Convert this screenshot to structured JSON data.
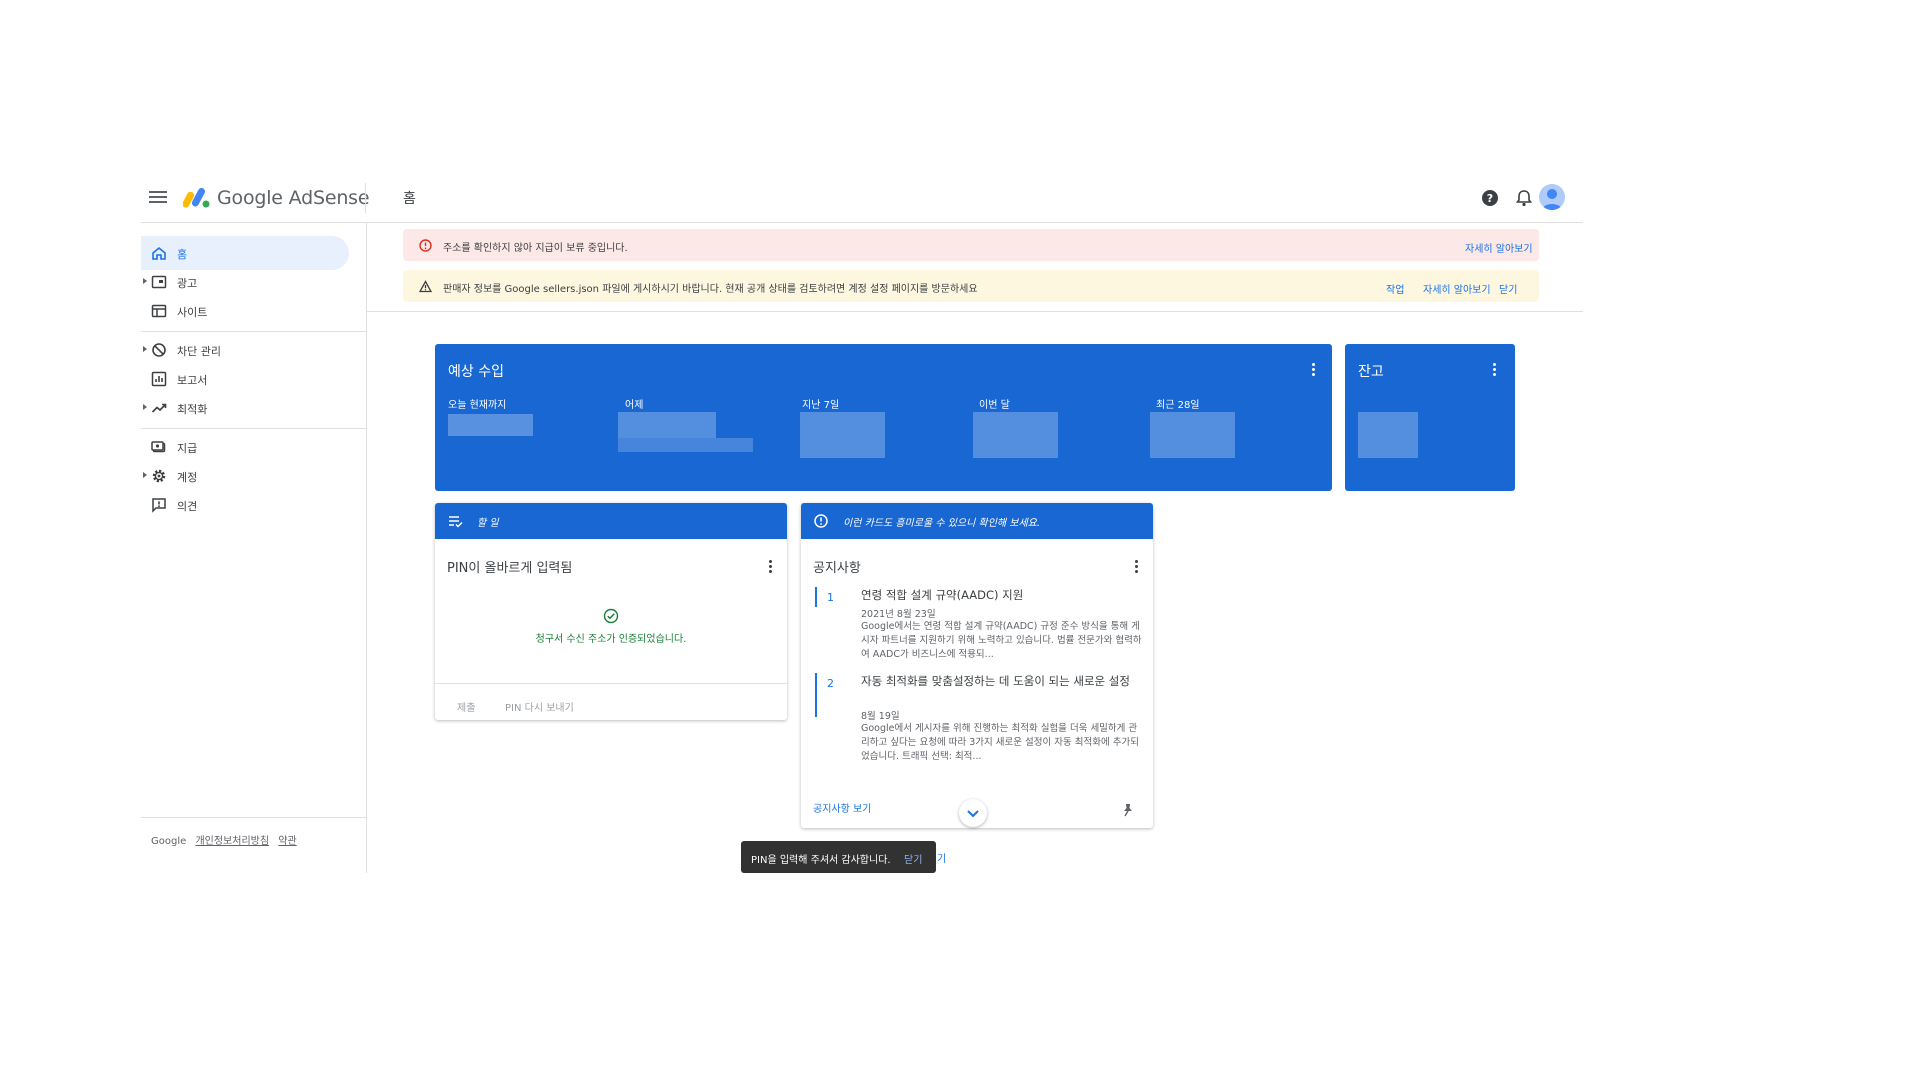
{
  "app": {
    "brand": "Google AdSense",
    "page_title": "홈",
    "colors": {
      "primary": "#1967d2",
      "link": "#1a73e8",
      "error_bg": "#fce8e6",
      "warn_bg": "#fef7e0",
      "success": "#188038"
    }
  },
  "header": {
    "icons": [
      "menu-icon",
      "help-icon",
      "notifications-icon",
      "account-avatar"
    ]
  },
  "sidebar": {
    "items": [
      {
        "label": "홈",
        "icon": "home-icon",
        "active": true
      },
      {
        "label": "광고",
        "icon": "ads-icon"
      },
      {
        "label": "사이트",
        "icon": "sites-icon"
      },
      {
        "label": "차단 관리",
        "icon": "block-icon"
      },
      {
        "label": "보고서",
        "icon": "reports-icon"
      },
      {
        "label": "최적화",
        "icon": "optimization-icon"
      },
      {
        "label": "지급",
        "icon": "payments-icon"
      },
      {
        "label": "계정",
        "icon": "settings-icon"
      },
      {
        "label": "의견",
        "icon": "feedback-icon"
      }
    ],
    "footer": {
      "brand": "Google",
      "privacy": "개인정보처리방침",
      "terms": "약관"
    }
  },
  "banners": {
    "error": {
      "text": "주소를 확인하지 않아 지급이 보류 중입니다.",
      "learn_more": "자세히 알아보기"
    },
    "warning": {
      "text": "판매자 정보를 Google sellers.json 파일에 게시하시기 바랍니다. 현재 공개 상태를 검토하려면 계정 설정 페이지를 방문하세요",
      "action": "작업",
      "learn_more": "자세히 알아보기",
      "close": "닫기"
    }
  },
  "earnings": {
    "title": "예상 수입",
    "metrics": [
      {
        "label": "오늘 현재까지"
      },
      {
        "label": "어제"
      },
      {
        "label": "지난 7일"
      },
      {
        "label": "이번 달"
      },
      {
        "label": "최근 28일"
      }
    ]
  },
  "balance": {
    "title": "잔고"
  },
  "todo_card": {
    "caption": "할 일",
    "title": "PIN이 올바르게 입력됨",
    "status": "청구서 수신 주소가 인증되었습니다.",
    "submit": "제출",
    "resend": "PIN 다시 보내기"
  },
  "notice_card": {
    "caption": "이런 카드도 흥미로울 수 있으니 확인해 보세요.",
    "title": "공지사항",
    "items": [
      {
        "num": "1",
        "title": "연령 적합 설계 규약(AADC) 지원",
        "date": "2021년 8월 23일",
        "body": "Google에서는 연령 적합 설계 규약(AADC) 규정 준수 방식을 통해 게시자 파트너를 지원하기 위해 노력하고 있습니다. 법률 전문가와 협력하여 AADC가 비즈니스에 적용되..."
      },
      {
        "num": "2",
        "title": "자동 최적화를 맞춤설정하는 데 도움이 되는 새로운 설정",
        "date": "8월 19일",
        "body": "Google에서 게시자를 위해 진행하는 최적화 실험을 더욱 세밀하게 관리하고 싶다는 요청에 따라 3가지 새로운 설정이 자동 최적화에 추가되었습니다. 트래픽 선택: 최적..."
      }
    ],
    "more": "공지사항 보기"
  },
  "snackbar": {
    "text": "PIN을 입력해 주셔서 감사합니다.",
    "close": "닫기"
  },
  "peek_text": "기"
}
